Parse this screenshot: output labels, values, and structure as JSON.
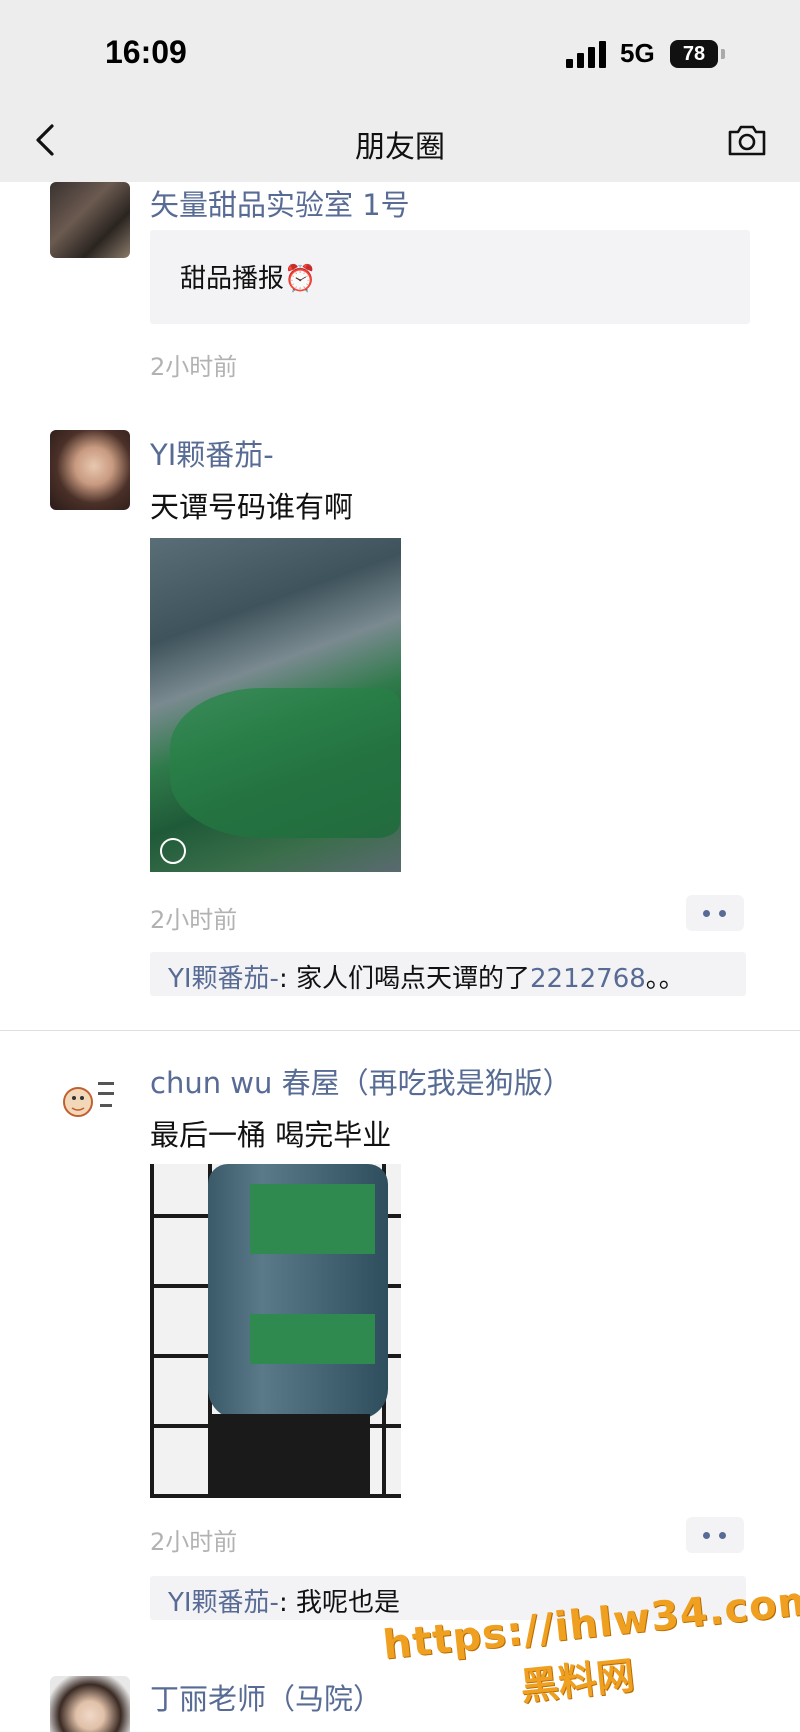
{
  "status_bar": {
    "time": "16:09",
    "network": "5G",
    "battery": "78"
  },
  "nav": {
    "title": "朋友圈",
    "back_icon": "chevron-left-icon",
    "camera_icon": "camera-icon"
  },
  "posts": [
    {
      "name": "矢量甜品实验室 1号",
      "shared_text": "甜品播报⏰",
      "time": "2小时前"
    },
    {
      "name": "YI颗番茄-",
      "text": "天谭号码谁有啊",
      "time": "2小时前",
      "comment": {
        "author": "YI颗番茄-",
        "sep": ": ",
        "text": "家人们喝点天谭的了",
        "number": "2212768",
        "tail": "。。"
      }
    },
    {
      "name": "chun wu 春屋（再吃我是狗版）",
      "text": "最后一桶 喝完毕业",
      "time": "2小时前",
      "comment": {
        "author": "YI颗番茄-",
        "sep": ": ",
        "text": "我呢也是"
      }
    },
    {
      "name": "丁丽老师（马院）"
    }
  ],
  "watermark": {
    "line1": "https://ihlw34.com",
    "line2": "黑料网"
  },
  "colors": {
    "link": "#576b95",
    "nav_bg": "#ededed",
    "comment_bg": "#f3f3f5",
    "watermark": "#f0a020"
  }
}
